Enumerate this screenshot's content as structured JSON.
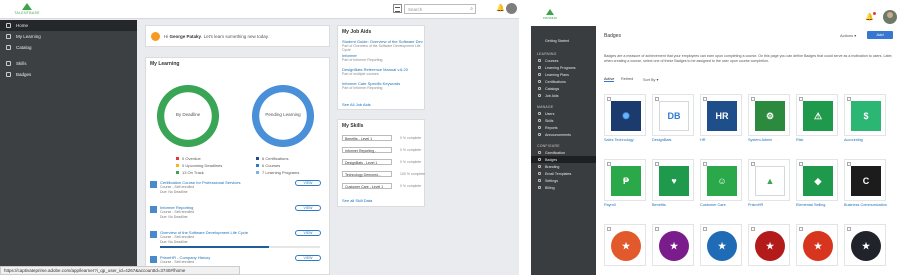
{
  "left": {
    "brand": "TALENTBASE",
    "search_placeholder": "Search",
    "sidebar": [
      {
        "label": "Home",
        "icon": "home-icon",
        "active": true
      },
      {
        "label": "My Learning",
        "icon": "book-icon",
        "active": false
      },
      {
        "label": "Catalog",
        "icon": "catalog-icon",
        "active": false
      },
      {
        "label": "Skills",
        "icon": "skills-icon",
        "active": false
      },
      {
        "label": "Badges",
        "icon": "badge-icon",
        "active": false
      }
    ],
    "welcome": {
      "prefix": "Hi",
      "name": "George Pataky",
      "message": "Let's learn something new today."
    },
    "my_learning": {
      "title": "My Learning",
      "ring1": {
        "label": "By Deadline",
        "color": "#3aa655"
      },
      "ring2": {
        "label": "Pending Learning",
        "color": "#4a90d9"
      },
      "legend1": [
        {
          "text": "0 Overdue",
          "color": "#e53935"
        },
        {
          "text": "0 Upcoming Deadlines",
          "color": "#f3b71b"
        },
        {
          "text": "13 On Track",
          "color": "#3aa655"
        }
      ],
      "legend2": [
        {
          "text": "6 Certifications",
          "color": "#1f4f8a"
        },
        {
          "text": "6 Courses",
          "color": "#2e7bc4"
        },
        {
          "text": "7 Learning Programs",
          "color": "#7fb3e6"
        }
      ],
      "courses": [
        {
          "name": "Certification Course for Professional Services",
          "type": "Course - Self-enrolled",
          "due": "Due: No Deadline",
          "button": "VIEW",
          "progress": 0
        },
        {
          "name": "Informer Reporting",
          "type": "Course - Self-enrolled",
          "due": "Due: No Deadline",
          "button": "VIEW",
          "progress": 0
        },
        {
          "name": "Overview of the Software Development Life Cycle",
          "type": "Course - Self-enrolled",
          "due": "Due: No Deadline",
          "button": "VIEW",
          "progress": 0.68
        },
        {
          "name": "PrismHR - Company History",
          "type": "Course - Self-enrolled",
          "due": "",
          "button": "VIEW",
          "progress": 0
        }
      ]
    },
    "job_aids": {
      "title": "My Job Aids",
      "items": [
        {
          "title": "Student Guide: Overview of the Software Dev",
          "sub": "Part of Overview of the Software Development Life Cycle"
        },
        {
          "title": "Informer",
          "sub": "Part of Informer Reporting"
        },
        {
          "title": "DesignBats Reference Manual v.6.20",
          "sub": "Part of multiple courses"
        },
        {
          "title": "Informer Cate Specific Keywords",
          "sub": "Part of Informer Reporting"
        }
      ],
      "see_all": "See All Job Aids"
    },
    "skills": {
      "title": "My Skills",
      "items": [
        {
          "name": "Benefits - Level 1",
          "pct": "0 % complete"
        },
        {
          "name": "Informer Reporting -",
          "pct": "0 % complete"
        },
        {
          "name": "DesignBats - Level 1",
          "pct": "0 % complete"
        },
        {
          "name": "Technology Demonst...",
          "pct": "100 % complete"
        },
        {
          "name": "Customer Care - Level 1",
          "pct": "0 % complete"
        }
      ],
      "see_all": "See all Skill Data"
    },
    "status_url": "https://captivateprime.adobe.com/app/learner?i_qp_user_id=4267&accountId=3740#/home"
  },
  "right": {
    "brand": "PRISMHR",
    "sidebar": {
      "top": [
        {
          "label": "Getting Started",
          "icon": "flag-icon"
        }
      ],
      "learning_header": "LEARNING",
      "learning": [
        {
          "label": "Courses",
          "icon": "course-icon"
        },
        {
          "label": "Learning Programs",
          "icon": "program-icon"
        },
        {
          "label": "Learning Plans",
          "icon": "plan-icon"
        },
        {
          "label": "Certifications",
          "icon": "cert-icon"
        },
        {
          "label": "Catalogs",
          "icon": "catalog-icon"
        },
        {
          "label": "Job Aids",
          "icon": "jobaid-icon"
        }
      ],
      "manage_header": "MANAGE",
      "manage": [
        {
          "label": "Users",
          "icon": "users-icon"
        },
        {
          "label": "Skills",
          "icon": "skills-icon"
        },
        {
          "label": "Reports",
          "icon": "reports-icon"
        },
        {
          "label": "Announcements",
          "icon": "announce-icon"
        }
      ],
      "configure_header": "CONFIGURE",
      "configure": [
        {
          "label": "Gamification",
          "icon": "game-icon",
          "active": false
        },
        {
          "label": "Badges",
          "icon": "badge-icon",
          "active": true
        },
        {
          "label": "Branding",
          "icon": "branding-icon",
          "active": false
        },
        {
          "label": "Email Templates",
          "icon": "email-icon",
          "active": false
        },
        {
          "label": "Settings",
          "icon": "settings-icon",
          "active": false
        },
        {
          "label": "Billing",
          "icon": "billing-icon",
          "active": false
        }
      ]
    },
    "page_title": "Badges",
    "actions_label": "Actions",
    "add_label": "Add",
    "description": "Badges are a measure of achievement that your employees can earn upon completing a course. On this page you can define Badges that could serve as a motivation to users. Later, when creating a course, select one of these Badges to be assigned to the user upon course completion.",
    "tabs": [
      "Active",
      "Retired"
    ],
    "sort_label": "Sort By",
    "badges": [
      {
        "label": "Sales Technology",
        "bg": "#1b3b6f",
        "fg": "#63b3ff",
        "glyph": "✺"
      },
      {
        "label": "DesignBats",
        "bg": "#ffffff",
        "fg": "#2c7dd3",
        "glyph": "DB"
      },
      {
        "label": "HR",
        "bg": "#1f4f8a",
        "fg": "#ffffff",
        "glyph": "HR"
      },
      {
        "label": "System Admin",
        "bg": "#2b8a3e",
        "fg": "#ffffff",
        "glyph": "⚙"
      },
      {
        "label": "Risk",
        "bg": "#1f9a4d",
        "fg": "#ffffff",
        "glyph": "⚠"
      },
      {
        "label": "Accounting",
        "bg": "#2bb673",
        "fg": "#ffffff",
        "glyph": "$"
      },
      {
        "label": "Payroll",
        "bg": "#2aa84a",
        "fg": "#ffffff",
        "glyph": "₱"
      },
      {
        "label": "Benefits",
        "bg": "#1f9a4d",
        "fg": "#ffffff",
        "glyph": "♥"
      },
      {
        "label": "Customer Care",
        "bg": "#2aa84a",
        "fg": "#ffffff",
        "glyph": "☺"
      },
      {
        "label": "PrismHR",
        "bg": "#ffffff",
        "fg": "#3aa655",
        "glyph": "▲"
      },
      {
        "label": "Elemental Selling",
        "bg": "#1f9a4d",
        "fg": "#ffffff",
        "glyph": "◆"
      },
      {
        "label": "Business Communication",
        "bg": "#1c1c1c",
        "fg": "#ffffff",
        "glyph": "C"
      },
      {
        "label": "",
        "bg": "#e25a2c",
        "fg": "#ffffff",
        "glyph": "★"
      },
      {
        "label": "",
        "bg": "#7a1c8c",
        "fg": "#ffffff",
        "glyph": "★"
      },
      {
        "label": "",
        "bg": "#1f6bb5",
        "fg": "#ffffff",
        "glyph": "★"
      },
      {
        "label": "",
        "bg": "#b31b1b",
        "fg": "#ffffff",
        "glyph": "★"
      },
      {
        "label": "",
        "bg": "#d8351f",
        "fg": "#ffffff",
        "glyph": "★"
      },
      {
        "label": "",
        "bg": "#20232a",
        "fg": "#ffffff",
        "glyph": "★"
      }
    ]
  }
}
